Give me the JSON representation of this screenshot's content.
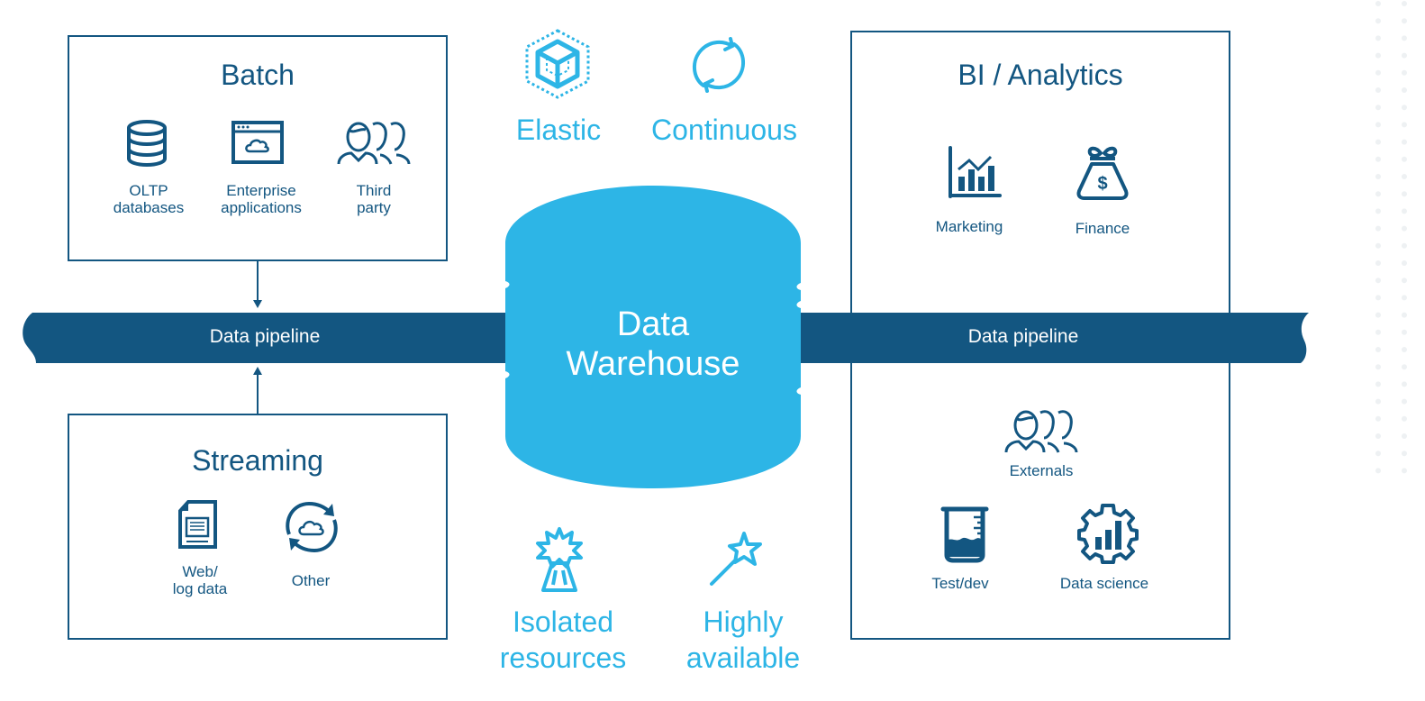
{
  "colors": {
    "dark_blue": "#135681",
    "light_blue": "#2db5e6",
    "white": "#ffffff"
  },
  "batch": {
    "title": "Batch",
    "items": [
      {
        "icon": "database-icon",
        "line1": "OLTP",
        "line2": "databases"
      },
      {
        "icon": "browser-cloud-icon",
        "line1": "Enterprise",
        "line2": "applications"
      },
      {
        "icon": "people-group-icon",
        "line1": "Third",
        "line2": "party"
      }
    ]
  },
  "streaming": {
    "title": "Streaming",
    "items": [
      {
        "icon": "document-icon",
        "line1": "Web/",
        "line2": "log data"
      },
      {
        "icon": "cloud-sync-icon",
        "line1": "Other",
        "line2": ""
      }
    ]
  },
  "pipelines": {
    "left_label": "Data pipeline",
    "right_label": "Data pipeline"
  },
  "warehouse": {
    "line1": "Data",
    "line2": "Warehouse"
  },
  "features_top": [
    {
      "icon": "elastic-cube-icon",
      "label": "Elastic"
    },
    {
      "icon": "refresh-cycle-icon",
      "label": "Continuous"
    }
  ],
  "features_bottom": [
    {
      "icon": "isolated-burst-icon",
      "line1": "Isolated",
      "line2": "resources"
    },
    {
      "icon": "magic-wand-icon",
      "line1": "Highly",
      "line2": "available"
    }
  ],
  "analytics": {
    "title": "BI / Analytics",
    "items": [
      {
        "icon": "bar-chart-icon",
        "label": "Marketing"
      },
      {
        "icon": "money-bag-icon",
        "label": "Finance"
      },
      {
        "icon": "people-group-icon",
        "label": "Externals"
      },
      {
        "icon": "beaker-icon",
        "label": "Test/dev"
      },
      {
        "icon": "gear-chart-icon",
        "label": "Data science"
      }
    ]
  }
}
